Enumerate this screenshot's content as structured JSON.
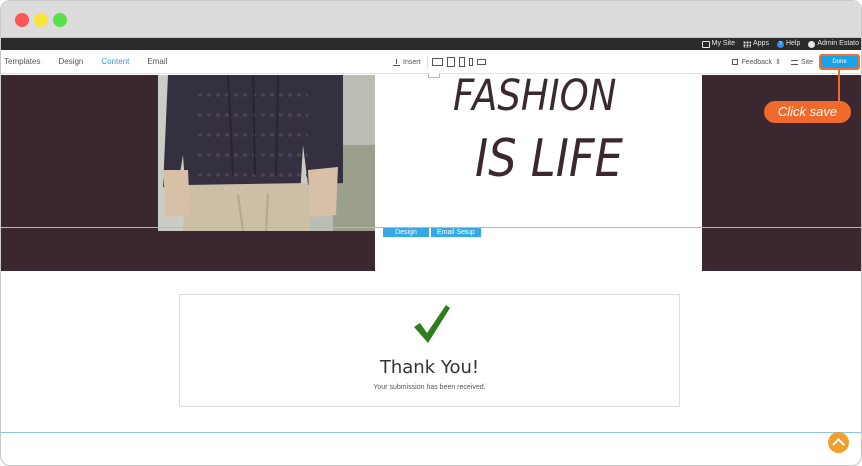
{
  "window": {
    "controls": [
      "close",
      "minimize",
      "maximize"
    ]
  },
  "admin_bar": {
    "links": [
      {
        "label": "My Site",
        "icon": "monitor-icon"
      },
      {
        "label": "Apps",
        "icon": "apps-grid-icon"
      },
      {
        "label": "Help",
        "icon": "help-icon"
      },
      {
        "label": "Admin Estato",
        "icon": "user-icon"
      }
    ]
  },
  "toolbar": {
    "tabs": [
      {
        "label": "Templates",
        "active": false
      },
      {
        "label": "Design",
        "active": false
      },
      {
        "label": "Content",
        "active": true
      },
      {
        "label": "Email",
        "active": false
      }
    ],
    "insert_label": "Insert",
    "devices": [
      "desktop-icon",
      "tablet-landscape-icon",
      "tablet-portrait-icon",
      "phone-icon",
      "phone-landscape-icon"
    ],
    "feedback_label": "Feedback",
    "site_label": "Site",
    "done_label": "Done"
  },
  "hero": {
    "headline_line1": "FASHION",
    "headline_line2": "IS LIFE",
    "background_color": "#3b2730"
  },
  "section_tabs": {
    "design_label": "Design",
    "email_setup_label": "Email Setup"
  },
  "callout": {
    "text": "Click save",
    "color": "#f06a2c"
  },
  "confirmation": {
    "title": "Thank You!",
    "message": "Your submission has been received."
  },
  "colors": {
    "accent": "#1aa3e8",
    "check": "#2e7d1e",
    "scroll_top": "#f0a02c"
  }
}
